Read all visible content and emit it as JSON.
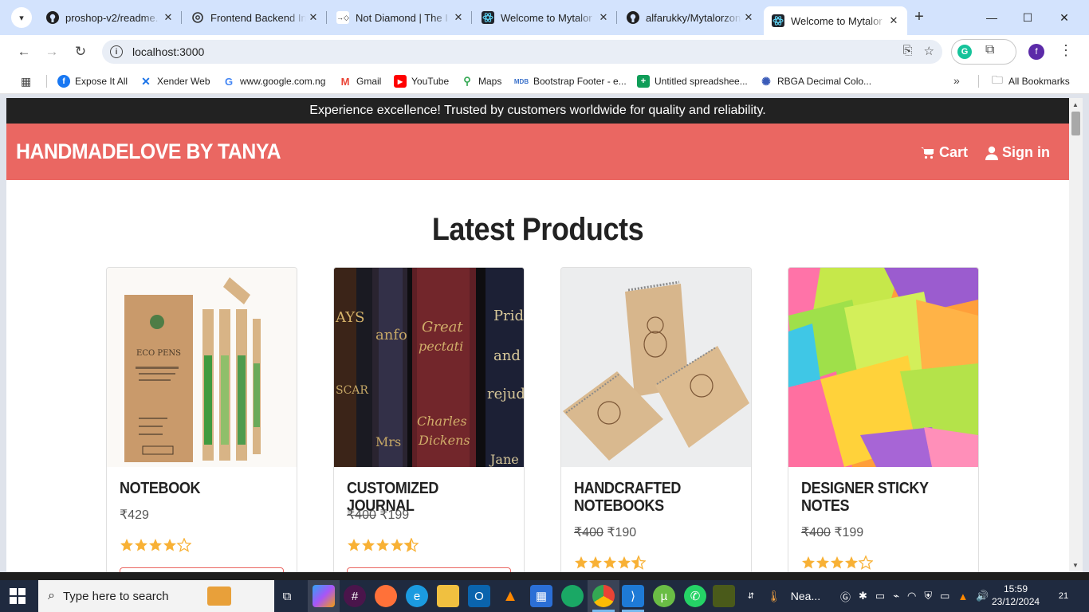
{
  "browser": {
    "tabs": [
      {
        "title": "proshop-v2/readme.",
        "icon": "github-icon",
        "active": false
      },
      {
        "title": "Frontend Backend In",
        "icon": "openai-icon",
        "active": false
      },
      {
        "title": "Not Diamond | The I",
        "icon": "notdiamond-icon",
        "active": false
      },
      {
        "title": "Welcome to Mytalor",
        "icon": "react-icon",
        "active": false
      },
      {
        "title": "alfarukky/Mytalorzon",
        "icon": "github-icon",
        "active": false
      },
      {
        "title": "Welcome to Mytalor",
        "icon": "react-icon",
        "active": true
      }
    ],
    "url": "localhost:3000",
    "avatar_letter": "f",
    "bookmarks": [
      {
        "label": "Expose It All",
        "icon": "facebook-icon"
      },
      {
        "label": "Xender Web",
        "icon": "xender-icon"
      },
      {
        "label": "www.google.com.ng",
        "icon": "google-icon"
      },
      {
        "label": "Gmail",
        "icon": "gmail-icon"
      },
      {
        "label": "YouTube",
        "icon": "youtube-icon"
      },
      {
        "label": "Maps",
        "icon": "maps-icon"
      },
      {
        "label": "Bootstrap Footer - e...",
        "icon": "mdb-icon"
      },
      {
        "label": "Untitled spreadshee...",
        "icon": "sheets-icon"
      },
      {
        "label": "RBGA Decimal Colo...",
        "icon": "react-icon"
      }
    ],
    "all_bookmarks": "All Bookmarks"
  },
  "site": {
    "announcement": "Experience excellence! Trusted by customers worldwide for quality and reliability.",
    "brand": "HANDMADELOVE BY TANYA",
    "nav": {
      "cart": "Cart",
      "signin": "Sign in"
    },
    "heading": "Latest Products",
    "products": [
      {
        "name": "NOTEBOOK",
        "old_price": "",
        "price": "₹429",
        "rating": 4
      },
      {
        "name": "CUSTOMIZED JOURNAL",
        "old_price": "₹400",
        "price": "₹199",
        "rating": 4.5
      },
      {
        "name": "HANDCRAFTED NOTEBOOKS",
        "old_price": "₹400",
        "price": "₹190",
        "rating": 4.5
      },
      {
        "name": "DESIGNER STICKY NOTES",
        "old_price": "₹400",
        "price": "₹199",
        "rating": 4
      }
    ],
    "colors": {
      "nav": "#ea6762",
      "announce": "#222222",
      "star": "#f8b135"
    }
  },
  "taskbar": {
    "search_placeholder": "Type here to search",
    "weather": "Nea...",
    "time": "15:59",
    "date": "23/12/2024",
    "notifications": "21"
  }
}
